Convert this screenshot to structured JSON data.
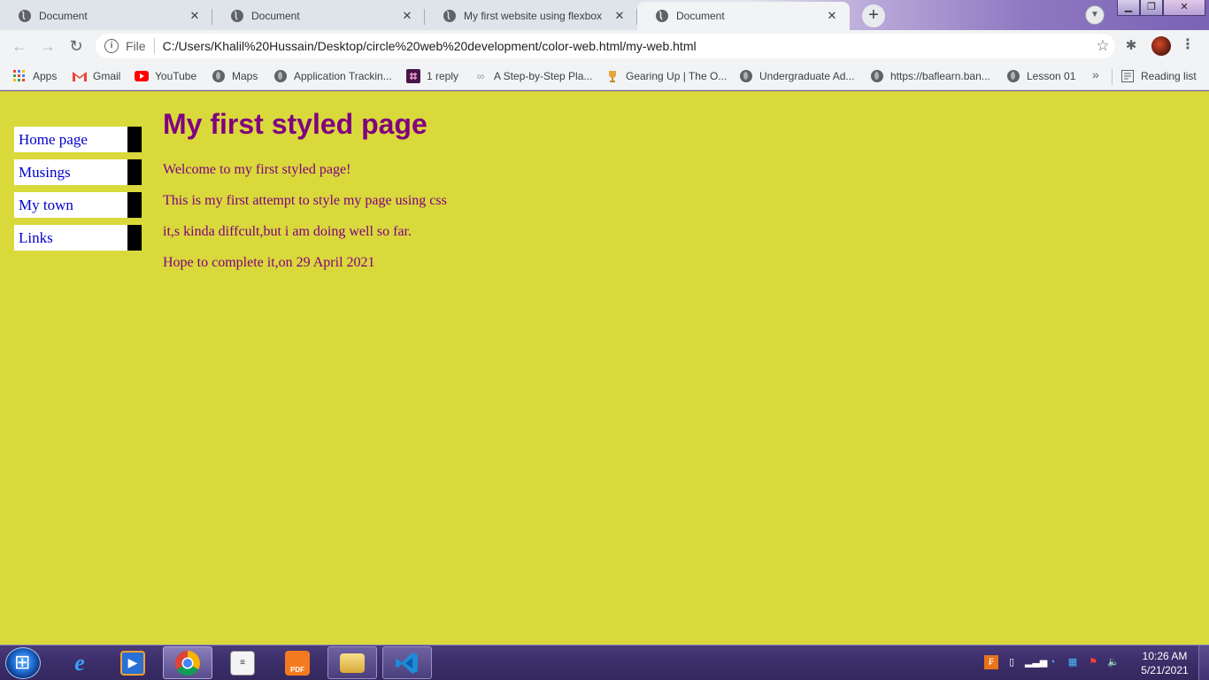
{
  "browser": {
    "tabs": [
      {
        "title": "Document",
        "active": false
      },
      {
        "title": "Document",
        "active": false
      },
      {
        "title": "My first website using flexbox",
        "active": false
      },
      {
        "title": "Document",
        "active": true
      }
    ],
    "new_tab_label": "+",
    "omnibox": {
      "scheme": "File",
      "url": "C:/Users/Khalil%20Hussain/Desktop/circle%20web%20development/color-web.html/my-web.html"
    },
    "bookmarks": [
      {
        "label": "Apps",
        "icon": "apps-grid-icon"
      },
      {
        "label": "Gmail",
        "icon": "gmail-icon"
      },
      {
        "label": "YouTube",
        "icon": "youtube-icon"
      },
      {
        "label": "Maps",
        "icon": "globe-icon"
      },
      {
        "label": "Application Trackin...",
        "icon": "globe-icon"
      },
      {
        "label": "1 reply",
        "icon": "slack-icon"
      },
      {
        "label": "A Step-by-Step Pla...",
        "icon": "link-icon"
      },
      {
        "label": "Gearing Up | The O...",
        "icon": "trophy-icon"
      },
      {
        "label": "Undergraduate Ad...",
        "icon": "globe-icon"
      },
      {
        "label": "https://baflearn.ban...",
        "icon": "globe-icon"
      },
      {
        "label": "Lesson 01",
        "icon": "globe-icon"
      }
    ],
    "more_bookmarks": "»",
    "reading_list": "Reading list"
  },
  "page": {
    "nav": [
      "Home page",
      "Musings",
      "My town",
      "Links"
    ],
    "heading": "My first styled page",
    "paragraphs": [
      "Welcome to my first styled page!",
      "This is my first attempt to style my page using css",
      "it,s kinda diffcult,but i am doing well so far.",
      "Hope to complete it,on 29 April 2021"
    ],
    "colors": {
      "background": "#d9d93b",
      "text": "#800080",
      "link": "#0000cc",
      "nav_border": "#000000"
    }
  },
  "taskbar": {
    "apps": [
      {
        "name": "internet-explorer",
        "state": "pinned"
      },
      {
        "name": "media-player",
        "state": "pinned"
      },
      {
        "name": "chrome",
        "state": "active"
      },
      {
        "name": "notepad",
        "state": "pinned"
      },
      {
        "name": "pdf-reader",
        "state": "pinned"
      },
      {
        "name": "file-explorer",
        "state": "open"
      },
      {
        "name": "vs-code",
        "state": "open"
      }
    ],
    "time": "10:26 AM",
    "date": "5/21/2021"
  }
}
